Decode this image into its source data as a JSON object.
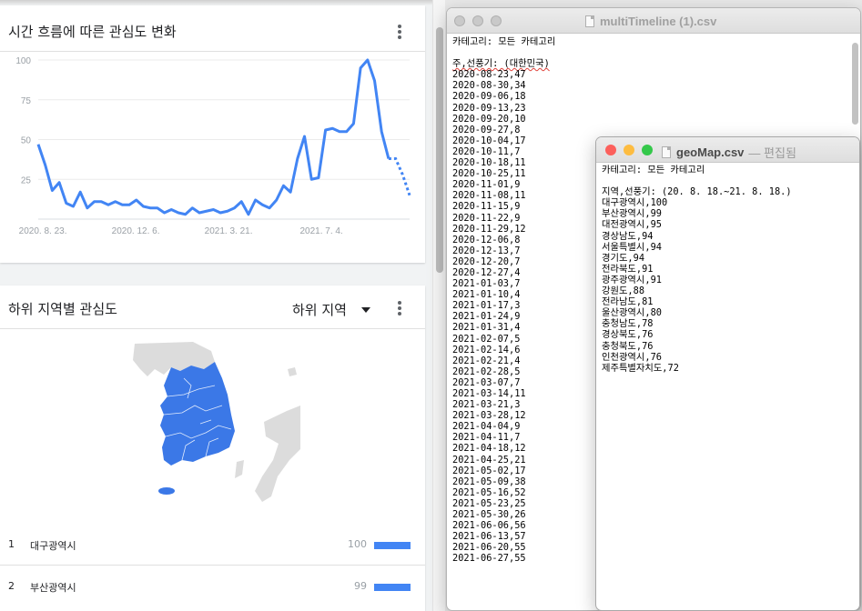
{
  "trends": {
    "time_card": {
      "title": "시간 흐름에 따른 관심도 변화",
      "chart_data": {
        "type": "line",
        "x_tick_labels": [
          "2020. 8. 23.",
          "2020. 12. 6.",
          "2021. 3. 21.",
          "2021. 7. 4."
        ],
        "y_ticks": [
          25,
          50,
          75,
          100
        ],
        "ylim": [
          0,
          100
        ],
        "grid": true,
        "series": [
          {
            "color": "#4285f4",
            "values": [
              47,
              34,
              18,
              23,
              10,
              8,
              17,
              7,
              11,
              11,
              9,
              11,
              9,
              9,
              12,
              8,
              7,
              7,
              4,
              6,
              4,
              3,
              7,
              4,
              5,
              6,
              4,
              5,
              7,
              11,
              3,
              12,
              9,
              7,
              12,
              21,
              17,
              38,
              52,
              25,
              26,
              56,
              57,
              55,
              55,
              60,
              95,
              100,
              87,
              55,
              38
            ],
            "partial_values": [
              38,
              28,
              15
            ]
          }
        ]
      }
    },
    "region_card": {
      "title": "하위 지역별 관심도",
      "dropdown_value": "하위 지역",
      "rankings": [
        {
          "rank": "1",
          "name": "대구광역시",
          "value": "100",
          "fraction": 1.0
        },
        {
          "rank": "2",
          "name": "부산광역시",
          "value": "99",
          "fraction": 0.99
        }
      ]
    }
  },
  "win1": {
    "title": "multiTimeline (1).csv",
    "lines": [
      "카테고리: 모든 카테고리",
      "",
      "주,선풍기: (대한민국)",
      "2020-08-23,47",
      "2020-08-30,34",
      "2020-09-06,18",
      "2020-09-13,23",
      "2020-09-20,10",
      "2020-09-27,8",
      "2020-10-04,17",
      "2020-10-11,7",
      "2020-10-18,11",
      "2020-10-25,11",
      "2020-11-01,9",
      "2020-11-08,11",
      "2020-11-15,9",
      "2020-11-22,9",
      "2020-11-29,12",
      "2020-12-06,8",
      "2020-12-13,7",
      "2020-12-20,7",
      "2020-12-27,4",
      "2021-01-03,7",
      "2021-01-10,4",
      "2021-01-17,3",
      "2021-01-24,9",
      "2021-01-31,4",
      "2021-02-07,5",
      "2021-02-14,6",
      "2021-02-21,4",
      "2021-02-28,5",
      "2021-03-07,7",
      "2021-03-14,11",
      "2021-03-21,3",
      "2021-03-28,12",
      "2021-04-04,9",
      "2021-04-11,7",
      "2021-04-18,12",
      "2021-04-25,21",
      "2021-05-02,17",
      "2021-05-09,38",
      "2021-05-16,52",
      "2021-05-23,25",
      "2021-05-30,26",
      "2021-06-06,56",
      "2021-06-13,57",
      "2021-06-20,55",
      "2021-06-27,55"
    ]
  },
  "win2": {
    "title": "geoMap.csv",
    "subtitle": "— 편집됨",
    "lines": [
      "카테고리: 모든 카테고리",
      "",
      "지역,선풍기: (20. 8. 18.~21. 8. 18.)",
      "대구광역시,100",
      "부산광역시,99",
      "대전광역시,95",
      "경상남도,94",
      "서울특별시,94",
      "경기도,94",
      "전라북도,91",
      "광주광역시,91",
      "강원도,88",
      "전라남도,81",
      "울산광역시,80",
      "충청남도,78",
      "경상북도,76",
      "충청북도,76",
      "인천광역시,76",
      "제주특별자치도,72"
    ]
  },
  "colors": {
    "accent": "#4285f4",
    "map_fill": "#3b78e7",
    "map_light": "#dcdcdc",
    "close": "#fc605c",
    "minimize": "#fdbc40",
    "zoom": "#34c84a"
  }
}
